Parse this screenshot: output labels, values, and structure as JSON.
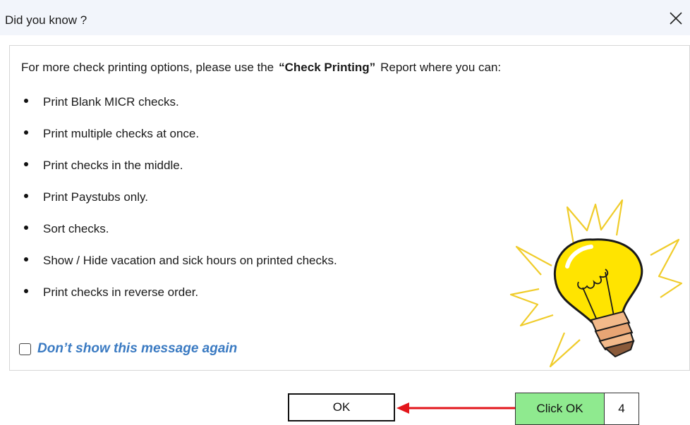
{
  "dialog": {
    "title": "Did you know ?",
    "close_icon": "close-icon"
  },
  "content": {
    "intro_before": "For more check printing options, please use the",
    "intro_highlight": "“Check Printing”",
    "intro_after": "Report where you can:",
    "bullets": [
      "Print Blank MICR checks.",
      "Print multiple checks at once.",
      "Print checks in the middle.",
      "Print Paystubs only.",
      "Sort checks.",
      "Show / Hide vacation and sick hours on printed checks.",
      "Print checks in reverse order."
    ],
    "illustration_icon": "light-bulb-icon"
  },
  "dont_show": {
    "label": "Don’t show this message again",
    "checked": false
  },
  "footer": {
    "ok_label": "OK"
  },
  "annotation": {
    "label": "Click OK",
    "step": "4",
    "box_color": "#8fea8f",
    "arrow_color": "#e3161b"
  }
}
